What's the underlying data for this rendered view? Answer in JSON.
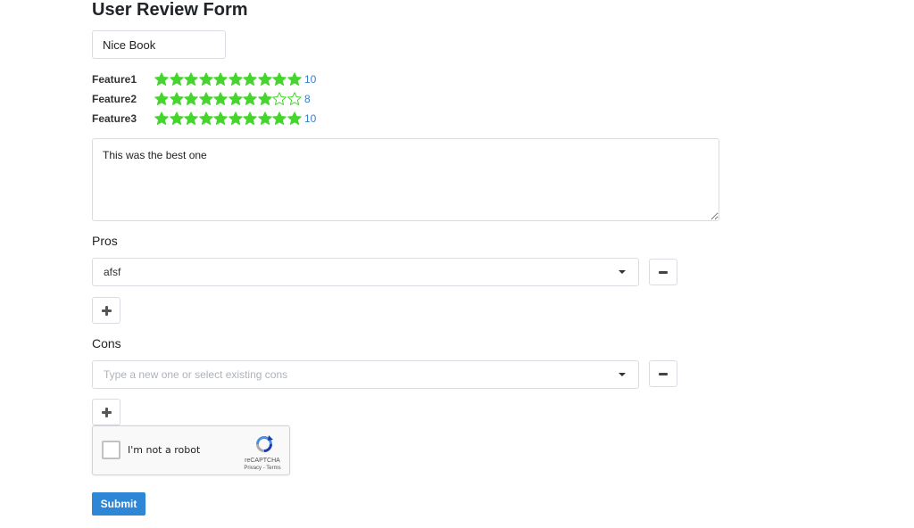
{
  "form": {
    "title": "User Review Form",
    "review_title_value": "Nice Book",
    "review_text_value": "This was the best one",
    "submit_label": "Submit"
  },
  "ratings": [
    {
      "label": "Feature1",
      "value": 10,
      "max": 10,
      "value_label": "10"
    },
    {
      "label": "Feature2",
      "value": 8,
      "max": 10,
      "value_label": "8"
    },
    {
      "label": "Feature3",
      "value": 10,
      "max": 10,
      "value_label": "10"
    }
  ],
  "pros": {
    "heading": "Pros",
    "selected_value": "afsf"
  },
  "cons": {
    "heading": "Cons",
    "placeholder": "Type a new one or select existing cons"
  },
  "captcha": {
    "label": "I'm not a robot",
    "brand": "reCAPTCHA",
    "privacy": "Privacy",
    "terms": "Terms",
    "links_separator": " - "
  },
  "colors": {
    "star_filled": "#44d62c",
    "star_empty_outline": "#44d62c",
    "rating_value": "#3a7fc4",
    "submit_bg": "#2e86d6"
  },
  "icons": {
    "star": "star-icon",
    "caret": "chevron-down-icon",
    "remove": "minus-icon",
    "add": "plus-icon",
    "captcha_logo": "recaptcha-logo-icon"
  }
}
